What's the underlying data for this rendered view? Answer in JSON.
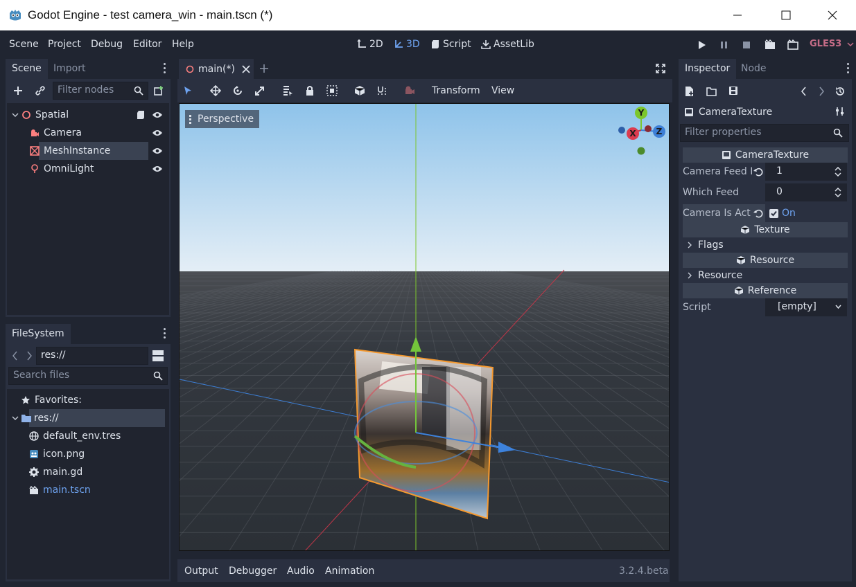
{
  "window": {
    "title": "Godot Engine - test camera_win - main.tscn (*)"
  },
  "menu": {
    "items": [
      "Scene",
      "Project",
      "Debug",
      "Editor",
      "Help"
    ]
  },
  "modes": {
    "m2d": "2D",
    "m3d": "3D",
    "script": "Script",
    "assetlib": "AssetLib"
  },
  "renderer": "GLES3",
  "scene_dock": {
    "tabs": [
      "Scene",
      "Import"
    ],
    "filter_placeholder": "Filter nodes",
    "nodes": [
      "Spatial",
      "Camera",
      "MeshInstance",
      "OmniLight"
    ]
  },
  "filesystem_dock": {
    "tab": "FileSystem",
    "path": "res://",
    "search_placeholder": "Search files",
    "favorites": "Favorites:",
    "root": "res://",
    "files": [
      "default_env.tres",
      "icon.png",
      "main.gd",
      "main.tscn"
    ]
  },
  "editor": {
    "scene_tab": "main(*)",
    "toolbar_menus": [
      "Transform",
      "View"
    ],
    "perspective_label": "Perspective",
    "gizmo_axes": {
      "x": "X",
      "y": "Y",
      "z": "Z"
    }
  },
  "bottom_panel": {
    "tabs": [
      "Output",
      "Debugger",
      "Audio",
      "Animation"
    ],
    "version": "3.2.4.beta"
  },
  "inspector": {
    "tabs": [
      "Inspector",
      "Node"
    ],
    "object_name": "CameraTexture",
    "filter_placeholder": "Filter properties",
    "sections": {
      "camera_texture": "CameraTexture",
      "texture": "Texture",
      "resource": "Resource",
      "reference": "Reference"
    },
    "props": {
      "camera_feed_label": "Camera Feed I",
      "camera_feed_value": "1",
      "which_feed_label": "Which Feed",
      "which_feed_value": "0",
      "camera_active_label": "Camera Is Acti",
      "camera_active_value": "On",
      "flags_label": "Flags",
      "resource_label": "Resource",
      "script_label": "Script",
      "script_value": "[empty]"
    }
  },
  "colors": {
    "accent": "#6ea3f0",
    "panel": "#2a3040",
    "background": "#202531",
    "renderer": "#c56c87"
  }
}
